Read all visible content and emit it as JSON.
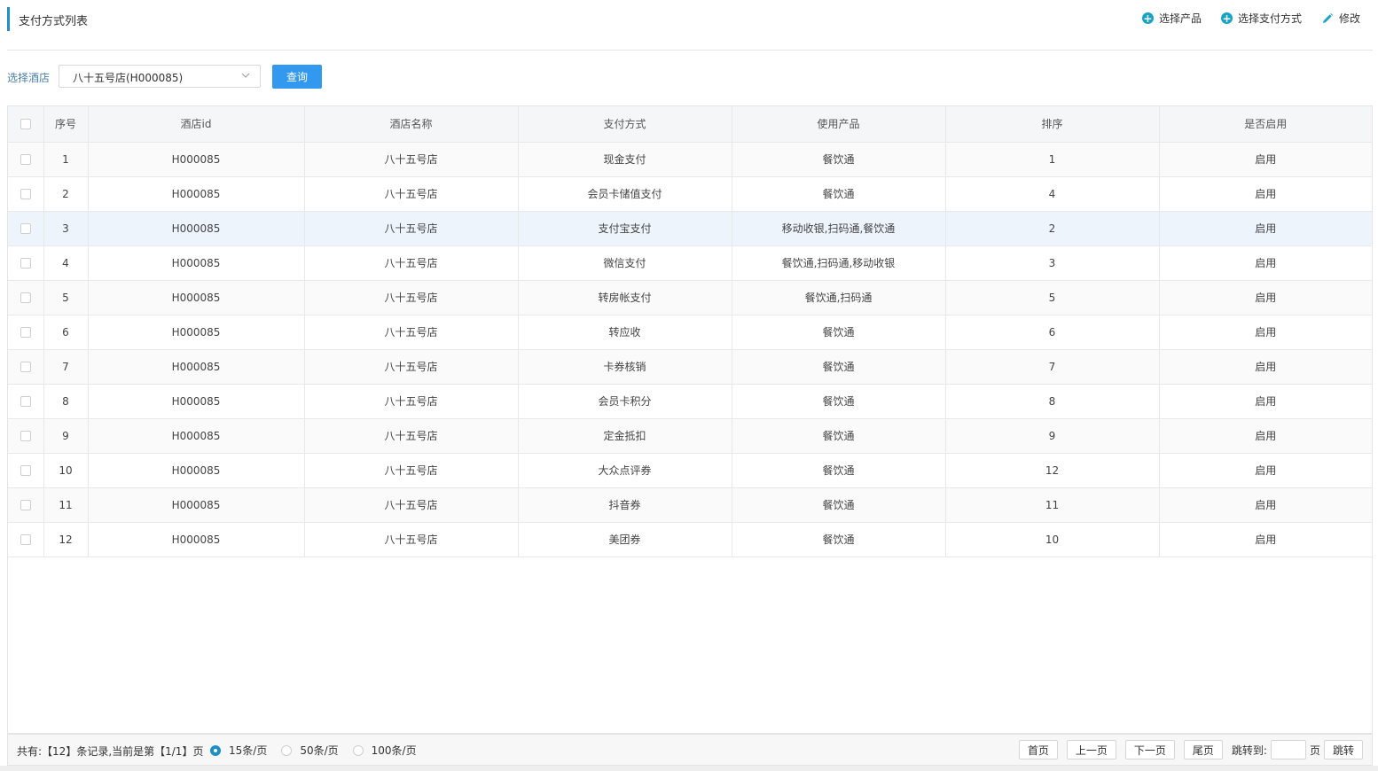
{
  "header": {
    "title": "支付方式列表",
    "actions": {
      "select_product": "选择产品",
      "select_payment": "选择支付方式",
      "edit": "修改"
    }
  },
  "filter": {
    "label": "选择酒店",
    "hotel_value": "八十五号店(H000085)",
    "query_label": "查询"
  },
  "table": {
    "headers": [
      "序号",
      "酒店id",
      "酒店名称",
      "支付方式",
      "使用产品",
      "排序",
      "是否启用"
    ],
    "rows": [
      [
        "1",
        "H000085",
        "八十五号店",
        "现金支付",
        "餐饮通",
        "1",
        "启用"
      ],
      [
        "2",
        "H000085",
        "八十五号店",
        "会员卡储值支付",
        "餐饮通",
        "4",
        "启用"
      ],
      [
        "3",
        "H000085",
        "八十五号店",
        "支付宝支付",
        "移动收银,扫码通,餐饮通",
        "2",
        "启用"
      ],
      [
        "4",
        "H000085",
        "八十五号店",
        "微信支付",
        "餐饮通,扫码通,移动收银",
        "3",
        "启用"
      ],
      [
        "5",
        "H000085",
        "八十五号店",
        "转房帐支付",
        "餐饮通,扫码通",
        "5",
        "启用"
      ],
      [
        "6",
        "H000085",
        "八十五号店",
        "转应收",
        "餐饮通",
        "6",
        "启用"
      ],
      [
        "7",
        "H000085",
        "八十五号店",
        "卡券核销",
        "餐饮通",
        "7",
        "启用"
      ],
      [
        "8",
        "H000085",
        "八十五号店",
        "会员卡积分",
        "餐饮通",
        "8",
        "启用"
      ],
      [
        "9",
        "H000085",
        "八十五号店",
        "定金抵扣",
        "餐饮通",
        "9",
        "启用"
      ],
      [
        "10",
        "H000085",
        "八十五号店",
        "大众点评券",
        "餐饮通",
        "12",
        "启用"
      ],
      [
        "11",
        "H000085",
        "八十五号店",
        "抖音券",
        "餐饮通",
        "11",
        "启用"
      ],
      [
        "12",
        "H000085",
        "八十五号店",
        "美团券",
        "餐饮通",
        "10",
        "启用"
      ]
    ]
  },
  "footer": {
    "record_info": "共有:【12】条记录,当前是第【1/1】页",
    "page_sizes": [
      "15条/页",
      "50条/页",
      "100条/页"
    ],
    "selected_page_size": "15条/页",
    "first": "首页",
    "prev": "上一页",
    "next": "下一页",
    "last": "尾页",
    "jump_label": "跳转到:",
    "page_unit": "页",
    "jump_button": "跳转"
  },
  "colors": {
    "accent": "#1e8fc8",
    "query_button": "#3399ee",
    "action_icon": "#17a2c8"
  }
}
